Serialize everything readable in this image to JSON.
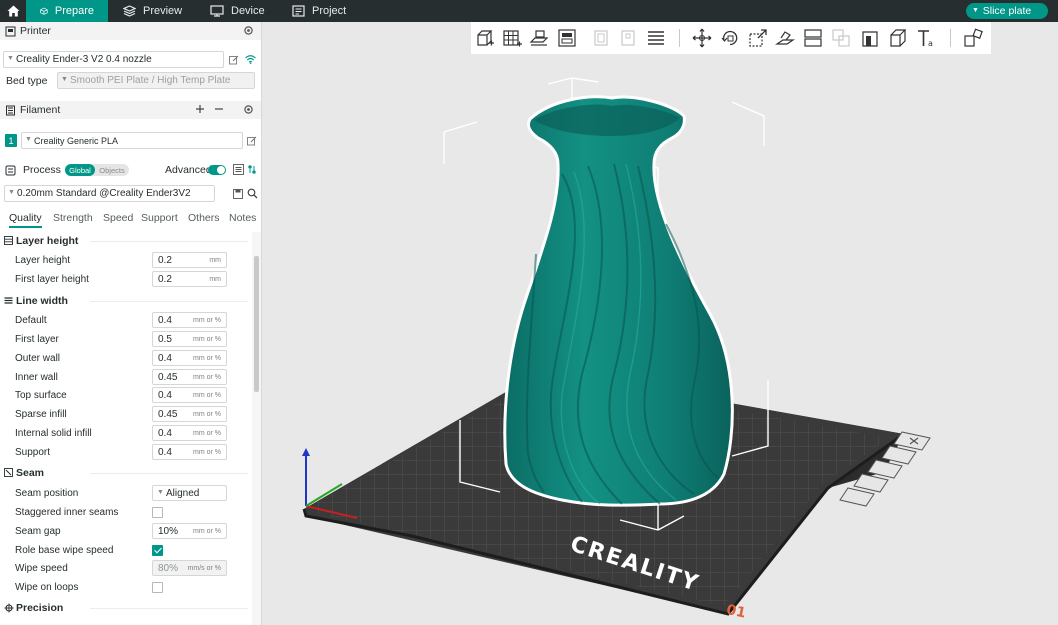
{
  "tabs": [
    {
      "label": "Prepare",
      "active": true
    },
    {
      "label": "Preview",
      "active": false
    },
    {
      "label": "Device",
      "active": false
    },
    {
      "label": "Project",
      "active": false
    }
  ],
  "slice_button": "Slice plate",
  "printer": {
    "title": "Printer",
    "name": "Creality Ender-3 V2 0.4 nozzle",
    "bed_type_label": "Bed type",
    "bed_type_value": "Smooth PEI Plate / High Temp Plate"
  },
  "filament": {
    "title": "Filament",
    "slot": "1",
    "name": "Creality Generic PLA"
  },
  "process": {
    "title": "Process",
    "global_label": "Global",
    "objects_label": "Objects",
    "advanced_label": "Advanced",
    "preset": "0.20mm Standard @Creality Ender3V2"
  },
  "setting_tabs": [
    "Quality",
    "Strength",
    "Speed",
    "Support",
    "Others",
    "Notes"
  ],
  "groups": {
    "layer_height": {
      "title": "Layer height",
      "rows": [
        {
          "label": "Layer height",
          "value": "0.2",
          "unit": "mm"
        },
        {
          "label": "First layer height",
          "value": "0.2",
          "unit": "mm"
        }
      ]
    },
    "line_width": {
      "title": "Line width",
      "rows": [
        {
          "label": "Default",
          "value": "0.4",
          "unit": "mm or %"
        },
        {
          "label": "First layer",
          "value": "0.5",
          "unit": "mm or %"
        },
        {
          "label": "Outer wall",
          "value": "0.4",
          "unit": "mm or %"
        },
        {
          "label": "Inner wall",
          "value": "0.45",
          "unit": "mm or %"
        },
        {
          "label": "Top surface",
          "value": "0.4",
          "unit": "mm or %"
        },
        {
          "label": "Sparse infill",
          "value": "0.45",
          "unit": "mm or %"
        },
        {
          "label": "Internal solid infill",
          "value": "0.4",
          "unit": "mm or %"
        },
        {
          "label": "Support",
          "value": "0.4",
          "unit": "mm or %"
        }
      ]
    },
    "seam": {
      "title": "Seam",
      "seam_position_label": "Seam position",
      "seam_position_value": "Aligned",
      "staggered_label": "Staggered inner seams",
      "seam_gap_label": "Seam gap",
      "seam_gap_value": "10%",
      "seam_gap_unit": "mm or %",
      "role_base_label": "Role base wipe speed",
      "wipe_speed_label": "Wipe speed",
      "wipe_speed_value": "80%",
      "wipe_speed_unit": "mm/s or %",
      "wipe_loops_label": "Wipe on loops"
    },
    "precision": {
      "title": "Precision"
    }
  },
  "bed_brand": "CREALITY",
  "plate_number": "01",
  "colors": {
    "accent": "#009688",
    "topbar": "#262e30",
    "model": "#0f7f76"
  }
}
